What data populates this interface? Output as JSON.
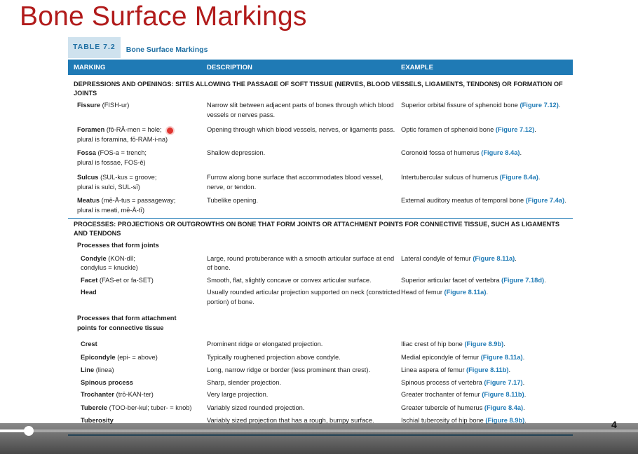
{
  "slide": {
    "title": "Bone Surface Markings",
    "page_number": "4"
  },
  "table": {
    "number": "TABLE 7.2",
    "name": "Bone Surface Markings",
    "columns": [
      "MARKING",
      "DESCRIPTION",
      "EXAMPLE"
    ],
    "section1": "DEPRESSIONS AND OPENINGS: SITES ALLOWING THE PASSAGE OF SOFT TISSUE (NERVES, BLOOD VESSELS, LIGAMENTS, TENDONS) OR FORMATION OF JOINTS",
    "rows1": [
      {
        "term": "Fissure",
        "pron": " (FISH-ur)",
        "plural": "",
        "desc": "Narrow slit between adjacent parts of bones through which blood vessels or nerves pass.",
        "ex": "Superior orbital fissure of sphenoid bone ",
        "fig": "(Figure 7.12)",
        "ex_end": "."
      },
      {
        "term": "Foramen",
        "pron": " (fō-RĀ-men = hole;",
        "plural": "plural is foramina, fō-RAM-i-na)",
        "desc": "Opening through which blood vessels, nerves, or ligaments pass.",
        "ex": "Optic foramen of sphenoid bone ",
        "fig": "(Figure 7.12)",
        "ex_end": "."
      },
      {
        "term": "Fossa",
        "pron": " (FOS-a = trench;",
        "plural": "plural is fossae, FOS-ē)",
        "desc": "Shallow depression.",
        "ex": "Coronoid fossa of humerus ",
        "fig": "(Figure 8.4a)",
        "ex_end": "."
      },
      {
        "term": "Sulcus",
        "pron": " (SUL-kus = groove;",
        "plural": "plural is sulci, SUL-sī)",
        "desc": "Furrow along bone surface that accommodates blood vessel, nerve, or tendon.",
        "ex": "Intertubercular sulcus of humerus ",
        "fig": "(Figure 8.4a)",
        "ex_end": "."
      },
      {
        "term": "Meatus",
        "pron": " (mē-Ā-tus = passageway;",
        "plural": "plural is meati, mē-Ā-tī)",
        "desc": "Tubelike opening.",
        "ex": "External auditory meatus of temporal bone ",
        "fig": "(Figure 7.4a)",
        "ex_end": "."
      }
    ],
    "section2": "PROCESSES: PROJECTIONS OR OUTGROWTHS ON BONE THAT FORM JOINTS OR ATTACHMENT POINTS FOR CONNECTIVE TISSUE, SUCH AS LIGAMENTS AND TENDONS",
    "subhead1": "Processes that form joints",
    "rows2": [
      {
        "term": "Condyle",
        "pron": " (KON-dīl;",
        "plural": "condylus = knuckle)",
        "desc": "Large, round protuberance with a smooth articular surface at end of bone.",
        "ex": "Lateral condyle of femur ",
        "fig": "(Figure 8.11a)",
        "ex_end": "."
      },
      {
        "term": "Facet",
        "pron": " (FAS-et or fa-SET)",
        "plural": "",
        "desc": "Smooth, flat, slightly concave or convex articular surface.",
        "ex": "Superior articular facet of vertebra ",
        "fig": "(Figure 7.18d)",
        "ex_end": "."
      },
      {
        "term": "Head",
        "pron": "",
        "plural": "",
        "desc": "Usually rounded articular projection supported on neck (constricted portion) of bone.",
        "ex": "Head of femur ",
        "fig": "(Figure 8.11a)",
        "ex_end": "."
      }
    ],
    "subhead2": "Processes that form attachment points for connective tissue",
    "rows3": [
      {
        "term": "Crest",
        "pron": "",
        "desc": "Prominent ridge or elongated projection.",
        "ex": "Iliac crest of hip bone ",
        "fig": "(Figure 8.9b)",
        "ex_end": "."
      },
      {
        "term": "Epicondyle",
        "pron": " (epi- = above)",
        "desc": "Typically roughened projection above condyle.",
        "ex": "Medial epicondyle of femur ",
        "fig": "(Figure 8.11a)",
        "ex_end": "."
      },
      {
        "term": "Line",
        "pron": " (linea)",
        "desc": "Long, narrow ridge or border (less prominent than crest).",
        "ex": "Linea aspera of femur ",
        "fig": "(Figure 8.11b)",
        "ex_end": "."
      },
      {
        "term": "Spinous process",
        "pron": "",
        "desc": "Sharp, slender projection.",
        "ex": "Spinous process of vertebra ",
        "fig": "(Figure 7.17)",
        "ex_end": "."
      },
      {
        "term": "Trochanter",
        "pron": " (trō-KAN-ter)",
        "desc": "Very large projection.",
        "ex": "Greater trochanter of femur ",
        "fig": "(Figure 8.11b)",
        "ex_end": "."
      },
      {
        "term": "Tubercle",
        "pron": " (TOO-ber-kul; tuber- = knob)",
        "desc": "Variably sized rounded projection.",
        "ex": "Greater tubercle of humerus ",
        "fig": "(Figure 8.4a)",
        "ex_end": "."
      },
      {
        "term": "Tuberosity",
        "pron": "",
        "desc": "Variably sized projection that has a rough, bumpy surface.",
        "ex": "Ischial tuberosity of hip bone ",
        "fig": "(Figure 8.9b)",
        "ex_end": "."
      }
    ]
  },
  "player": {
    "progress": 0.045
  }
}
